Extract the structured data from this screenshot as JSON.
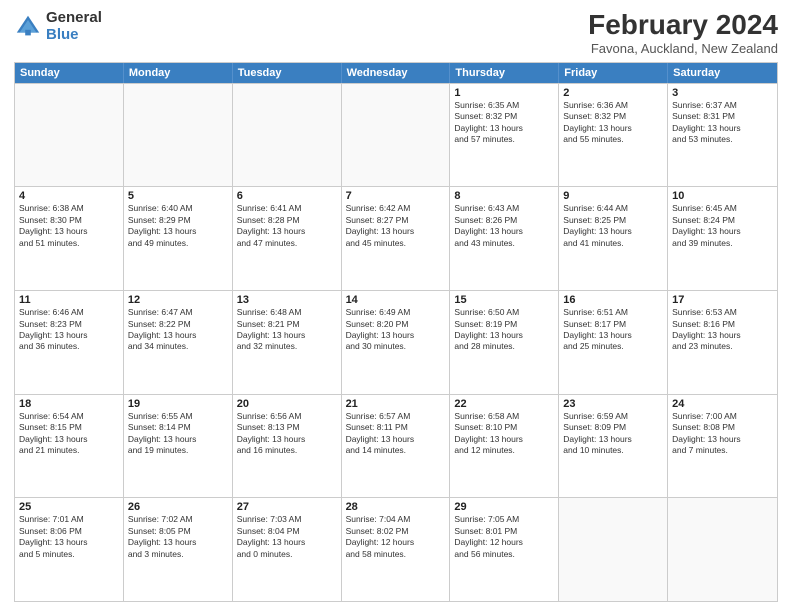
{
  "logo": {
    "general": "General",
    "blue": "Blue"
  },
  "header": {
    "title": "February 2024",
    "subtitle": "Favona, Auckland, New Zealand"
  },
  "days_of_week": [
    "Sunday",
    "Monday",
    "Tuesday",
    "Wednesday",
    "Thursday",
    "Friday",
    "Saturday"
  ],
  "weeks": [
    [
      {
        "day": "",
        "empty": true
      },
      {
        "day": "",
        "empty": true
      },
      {
        "day": "",
        "empty": true
      },
      {
        "day": "",
        "empty": true
      },
      {
        "day": "1",
        "sunrise": "6:35 AM",
        "sunset": "8:32 PM",
        "daylight": "13 hours and 57 minutes."
      },
      {
        "day": "2",
        "sunrise": "6:36 AM",
        "sunset": "8:32 PM",
        "daylight": "13 hours and 55 minutes."
      },
      {
        "day": "3",
        "sunrise": "6:37 AM",
        "sunset": "8:31 PM",
        "daylight": "13 hours and 53 minutes."
      }
    ],
    [
      {
        "day": "4",
        "sunrise": "6:38 AM",
        "sunset": "8:30 PM",
        "daylight": "13 hours and 51 minutes."
      },
      {
        "day": "5",
        "sunrise": "6:40 AM",
        "sunset": "8:29 PM",
        "daylight": "13 hours and 49 minutes."
      },
      {
        "day": "6",
        "sunrise": "6:41 AM",
        "sunset": "8:28 PM",
        "daylight": "13 hours and 47 minutes."
      },
      {
        "day": "7",
        "sunrise": "6:42 AM",
        "sunset": "8:27 PM",
        "daylight": "13 hours and 45 minutes."
      },
      {
        "day": "8",
        "sunrise": "6:43 AM",
        "sunset": "8:26 PM",
        "daylight": "13 hours and 43 minutes."
      },
      {
        "day": "9",
        "sunrise": "6:44 AM",
        "sunset": "8:25 PM",
        "daylight": "13 hours and 41 minutes."
      },
      {
        "day": "10",
        "sunrise": "6:45 AM",
        "sunset": "8:24 PM",
        "daylight": "13 hours and 39 minutes."
      }
    ],
    [
      {
        "day": "11",
        "sunrise": "6:46 AM",
        "sunset": "8:23 PM",
        "daylight": "13 hours and 36 minutes."
      },
      {
        "day": "12",
        "sunrise": "6:47 AM",
        "sunset": "8:22 PM",
        "daylight": "13 hours and 34 minutes."
      },
      {
        "day": "13",
        "sunrise": "6:48 AM",
        "sunset": "8:21 PM",
        "daylight": "13 hours and 32 minutes."
      },
      {
        "day": "14",
        "sunrise": "6:49 AM",
        "sunset": "8:20 PM",
        "daylight": "13 hours and 30 minutes."
      },
      {
        "day": "15",
        "sunrise": "6:50 AM",
        "sunset": "8:19 PM",
        "daylight": "13 hours and 28 minutes."
      },
      {
        "day": "16",
        "sunrise": "6:51 AM",
        "sunset": "8:17 PM",
        "daylight": "13 hours and 25 minutes."
      },
      {
        "day": "17",
        "sunrise": "6:53 AM",
        "sunset": "8:16 PM",
        "daylight": "13 hours and 23 minutes."
      }
    ],
    [
      {
        "day": "18",
        "sunrise": "6:54 AM",
        "sunset": "8:15 PM",
        "daylight": "13 hours and 21 minutes."
      },
      {
        "day": "19",
        "sunrise": "6:55 AM",
        "sunset": "8:14 PM",
        "daylight": "13 hours and 19 minutes."
      },
      {
        "day": "20",
        "sunrise": "6:56 AM",
        "sunset": "8:13 PM",
        "daylight": "13 hours and 16 minutes."
      },
      {
        "day": "21",
        "sunrise": "6:57 AM",
        "sunset": "8:11 PM",
        "daylight": "13 hours and 14 minutes."
      },
      {
        "day": "22",
        "sunrise": "6:58 AM",
        "sunset": "8:10 PM",
        "daylight": "13 hours and 12 minutes."
      },
      {
        "day": "23",
        "sunrise": "6:59 AM",
        "sunset": "8:09 PM",
        "daylight": "13 hours and 10 minutes."
      },
      {
        "day": "24",
        "sunrise": "7:00 AM",
        "sunset": "8:08 PM",
        "daylight": "13 hours and 7 minutes."
      }
    ],
    [
      {
        "day": "25",
        "sunrise": "7:01 AM",
        "sunset": "8:06 PM",
        "daylight": "13 hours and 5 minutes."
      },
      {
        "day": "26",
        "sunrise": "7:02 AM",
        "sunset": "8:05 PM",
        "daylight": "13 hours and 3 minutes."
      },
      {
        "day": "27",
        "sunrise": "7:03 AM",
        "sunset": "8:04 PM",
        "daylight": "13 hours and 0 minutes."
      },
      {
        "day": "28",
        "sunrise": "7:04 AM",
        "sunset": "8:02 PM",
        "daylight": "12 hours and 58 minutes."
      },
      {
        "day": "29",
        "sunrise": "7:05 AM",
        "sunset": "8:01 PM",
        "daylight": "12 hours and 56 minutes."
      },
      {
        "day": "",
        "empty": true
      },
      {
        "day": "",
        "empty": true
      }
    ]
  ]
}
